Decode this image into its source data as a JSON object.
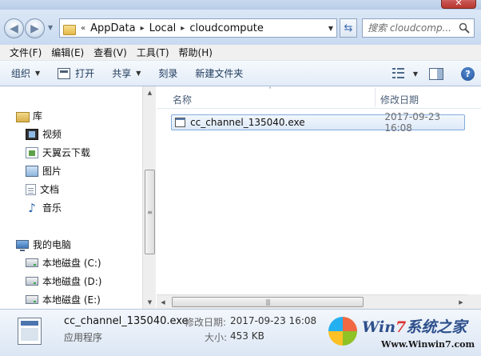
{
  "window": {
    "close_label": "✕"
  },
  "address_bar": {
    "overflow_marker": "«",
    "crumbs": [
      "AppData",
      "Local",
      "cloudcompute"
    ],
    "separator": "▸"
  },
  "search": {
    "placeholder": "搜索 cloudcomp..."
  },
  "menu": {
    "items": [
      "文件(F)",
      "编辑(E)",
      "查看(V)",
      "工具(T)",
      "帮助(H)"
    ]
  },
  "toolbar": {
    "organize_label": "组织",
    "open_label": "打开",
    "share_label": "共享",
    "burn_label": "刻录",
    "new_folder_label": "新建文件夹",
    "help_label": "?"
  },
  "nav_pane": {
    "library_label": "库",
    "library_items": [
      "视频",
      "天翼云下载",
      "图片",
      "文档",
      "音乐"
    ],
    "computer_label": "我的电脑",
    "drives": [
      "本地磁盘 (C:)",
      "本地磁盘 (D:)",
      "本地磁盘 (E:)"
    ]
  },
  "columns": {
    "name": "名称",
    "modified": "修改日期"
  },
  "files": [
    {
      "name": "cc_channel_135040.exe",
      "modified": "2017-09-23 16:08"
    }
  ],
  "details": {
    "name": "cc_channel_135040.exe",
    "type": "应用程序",
    "modified_label": "修改日期:",
    "modified_value": "2017-09-23 16:08",
    "size_label": "大小:",
    "size_value": "453 KB"
  },
  "watermark": {
    "brand_prefix": "Win",
    "brand_seven": "7",
    "brand_suffix": "系统之家",
    "url": "Www.Winwin7.com"
  },
  "colors": {
    "selection_border": "#84acdd",
    "toolbar_text": "#1e395b",
    "close_red": "#c75050"
  }
}
